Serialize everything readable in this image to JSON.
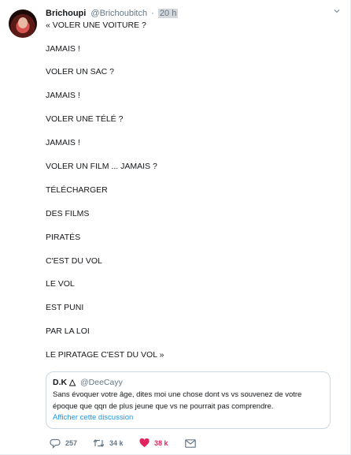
{
  "tweet": {
    "author_name": "Brichoupi",
    "author_handle": "@Brichoubitch",
    "separator": "·",
    "time": "20 h",
    "lines": [
      "« VOLER UNE VOITURE ?",
      "JAMAIS !",
      "VOLER UN SAC ?",
      "JAMAIS !",
      "VOLER UNE TÉLÉ ?",
      "JAMAIS !",
      "VOLER UN FILM ... JAMAIS ?",
      "TÉLÉCHARGER",
      "DES FILMS",
      "PIRATÉS",
      "C'EST DU VOL",
      "LE VOL",
      "EST PUNI",
      "PAR LA LOI",
      "LE PIRATAGE C'EST DU VOL »"
    ]
  },
  "quote": {
    "author_name": "D.K △",
    "author_handle": "@DeeCayy",
    "text": "Sans évoquer votre âge, dites moi une chose dont vs vs souvenez de votre époque que qqn de plus jeune que vs ne pourrait pas comprendre.",
    "link": "Afficher cette discussion"
  },
  "actions": {
    "replies": "257",
    "retweets": "34 k",
    "likes": "38 k"
  },
  "colors": {
    "accent": "#1b95e0",
    "like": "#e0245e",
    "muted": "#657786"
  },
  "icons": [
    "chevron-down-icon",
    "reply-icon",
    "retweet-icon",
    "heart-icon",
    "message-icon"
  ]
}
